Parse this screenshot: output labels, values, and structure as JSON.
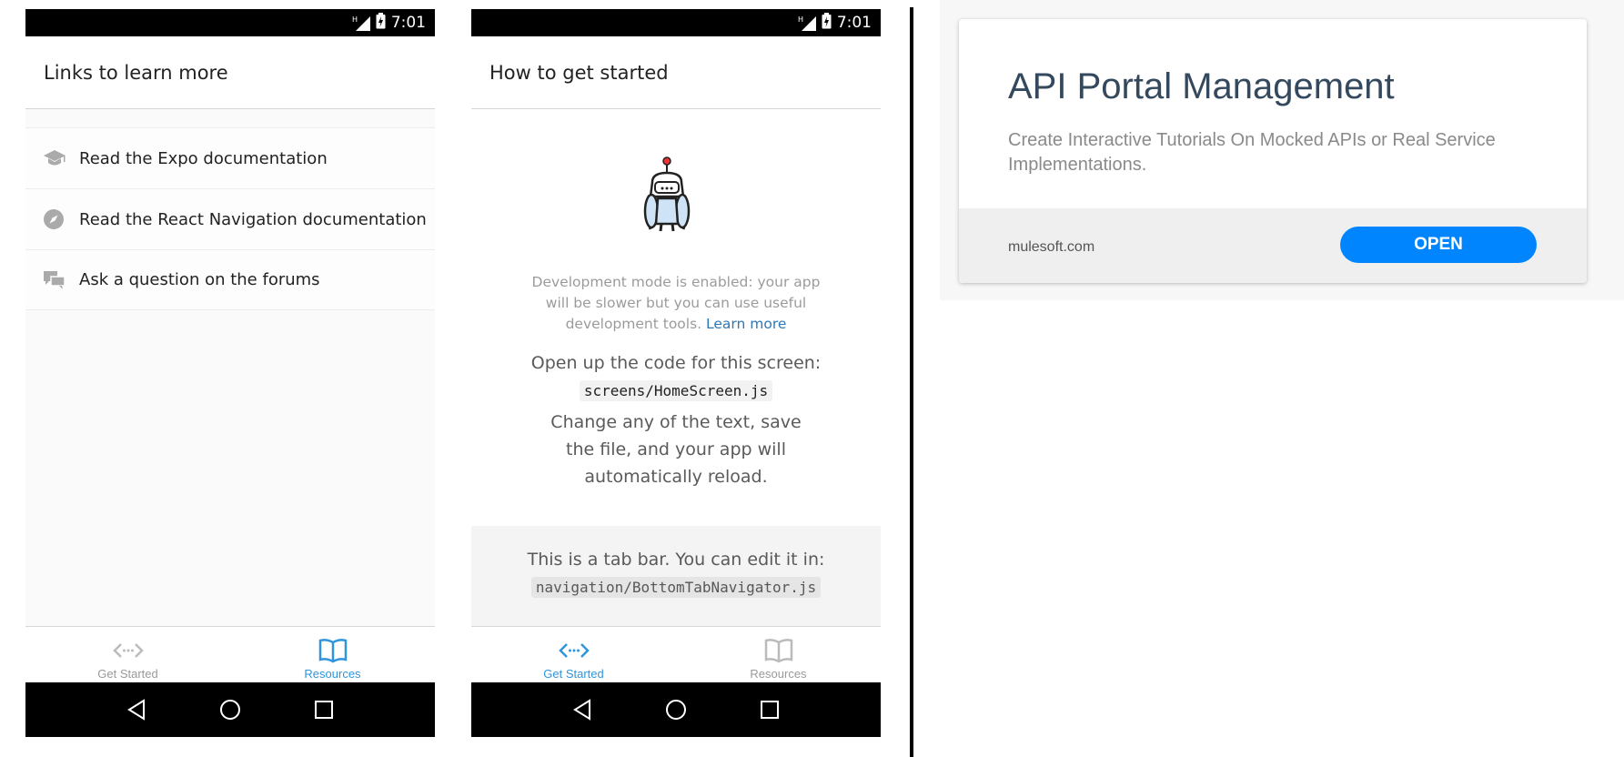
{
  "colors": {
    "tab_active": "#2f95dc",
    "tab_inactive": "#999999",
    "link": "#2e78b7",
    "open_button": "#0085ff",
    "card_title": "#34495e"
  },
  "status_bar": {
    "time": "7:01",
    "network": "H"
  },
  "phone_resources": {
    "header_title": "Links to learn more",
    "links": [
      {
        "label": "Read the Expo documentation",
        "icon": "school-icon"
      },
      {
        "label": "Read the React Navigation documentation",
        "icon": "compass-icon"
      },
      {
        "label": "Ask a question on the forums",
        "icon": "chat-icon"
      }
    ],
    "tabs": [
      {
        "label": "Get Started",
        "icon": "code-icon",
        "active": false
      },
      {
        "label": "Resources",
        "icon": "book-icon",
        "active": true
      }
    ]
  },
  "phone_home": {
    "header_title": "How to get started",
    "dev_text": "Development mode is enabled: your app will be slower but you can use useful development tools.",
    "learn_more": "Learn more",
    "open_code_text": "Open up the code for this screen:",
    "code_path": "screens/HomeScreen.js",
    "change_text": "Change any of the text, save the file, and your app will automatically reload.",
    "tab_info_text": "This is a tab bar. You can edit it in:",
    "tab_info_path": "navigation/BottomTabNavigator.js",
    "tabs": [
      {
        "label": "Get Started",
        "icon": "code-icon",
        "active": true
      },
      {
        "label": "Resources",
        "icon": "book-icon",
        "active": false
      }
    ]
  },
  "card": {
    "title": "API Portal Management",
    "description": "Create Interactive Tutorials On Mocked APIs or Real Service Implementations.",
    "domain": "mulesoft.com",
    "button_label": "OPEN"
  }
}
